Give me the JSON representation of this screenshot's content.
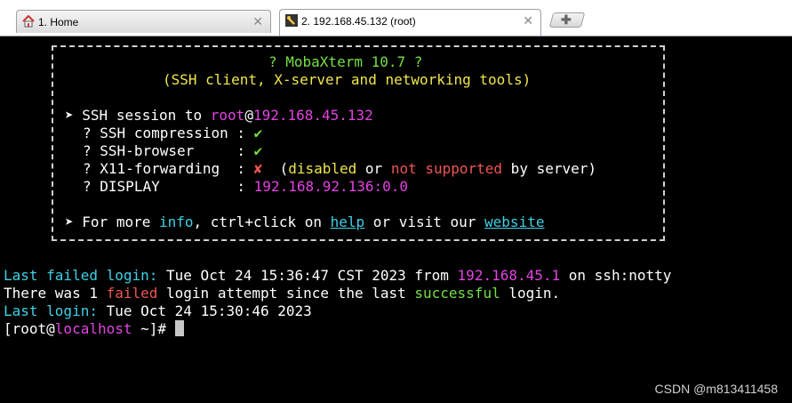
{
  "tabs": [
    {
      "label": "1. Home",
      "icon": "home-icon",
      "active": false
    },
    {
      "label": "2. 192.168.45.132 (root)",
      "icon": "terminal-icon",
      "active": true
    }
  ],
  "close_glyph": "✕",
  "new_tab_glyph": "✚",
  "banner": {
    "title": "? MobaXterm 10.7 ?",
    "subtitle": "(SSH client, X-server and networking tools)",
    "arrow": "➤",
    "session_prefix": "SSH session to ",
    "user": "root",
    "at": "@",
    "host": "192.168.45.132",
    "q": "?",
    "compression_label": "SSH compression : ",
    "browser_label": "SSH-browser     : ",
    "x11_label": "X11-forwarding  : ",
    "display_label": "DISPLAY         : ",
    "check": "✔",
    "cross": "✘",
    "x11_open": "  (",
    "disabled": "disabled",
    "or": " or ",
    "not_supported": "not supported",
    "by_server": " by server)",
    "display_value": "192.168.92.136:0.0",
    "more_prefix": "For more ",
    "info": "info",
    "ctrl_click": ", ctrl+click on ",
    "help": "help",
    "visit": " or visit our ",
    "website": "website"
  },
  "terminal": {
    "failed_label": "Last failed login:",
    "failed_date": " Tue Oct 24 15:36:47 CST 2023 from ",
    "failed_ip": "192.168.45.1",
    "failed_via": " on ssh:notty",
    "attempt_pre": "There was 1 ",
    "attempt_failed": "failed",
    "attempt_mid": " login attempt since the last ",
    "attempt_success": "successful",
    "attempt_post": " login.",
    "last_label": "Last login:",
    "last_date": " Tue Oct 24 15:30:46 2023",
    "prompt_open": "[root@",
    "prompt_host": "localhost",
    "prompt_close": " ~]# "
  },
  "watermark": "CSDN @m813411458",
  "colors": {
    "green": "#74e043",
    "yellow": "#f0e64b",
    "magenta": "#e243e2",
    "cyan": "#3fd0e6",
    "red": "#f05555"
  }
}
